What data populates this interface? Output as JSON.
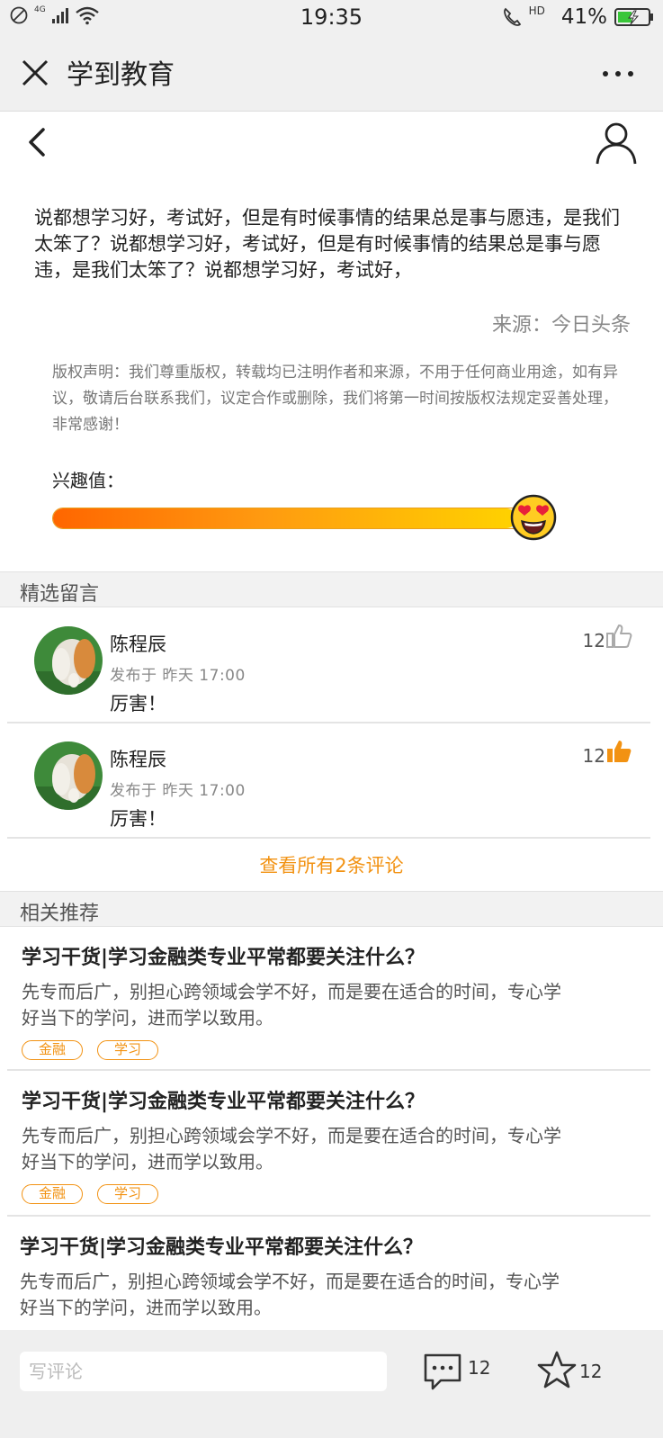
{
  "status_bar": {
    "network": "4G",
    "time": "19:35",
    "call_badge": "HD",
    "battery": "41%"
  },
  "title_bar": {
    "title": "学到教育"
  },
  "article": {
    "body": "说都想学习好，考试好，但是有时候事情的结果总是事与愿违，是我们太笨了？说都想学习好，考试好，但是有时候事情的结果总是事与愿违，是我们太笨了？说都想学习好，考试好，",
    "source": "来源：今日头条",
    "copyright": "版权声明：我们尊重版权，转载均已注明作者和来源，不用于任何商业用途，如有异议，敬请后台联系我们，议定合作或删除，我们将第一时间按版权法规定妥善处理，非常感谢！",
    "interest_label": "兴趣值：",
    "interest_value_percent": 95
  },
  "comments_section": {
    "title": "精选留言",
    "comments": [
      {
        "name": "陈程辰",
        "time": "发布于 昨天 17:00",
        "text": "厉害！",
        "likes": "12",
        "liked": false
      },
      {
        "name": "陈程辰",
        "time": "发布于 昨天 17:00",
        "text": "厉害！",
        "likes": "12",
        "liked": true
      }
    ],
    "view_all": "查看所有2条评论"
  },
  "recommend_section": {
    "title": "相关推荐",
    "items": [
      {
        "title": "学习干货|学习金融类专业平常都要关注什么？",
        "desc": "先专而后广，别担心跨领域会学不好，而是要在适合的时间，专心学好当下的学问，进而学以致用。",
        "tags": [
          "金融",
          "学习"
        ]
      },
      {
        "title": "学习干货|学习金融类专业平常都要关注什么？",
        "desc": "先专而后广，别担心跨领域会学不好，而是要在适合的时间，专心学好当下的学问，进而学以致用。",
        "tags": [
          "金融",
          "学习"
        ]
      },
      {
        "title": "学习干货|学习金融类专业平常都要关注什么？",
        "desc": "先专而后广，别担心跨领域会学不好，而是要在适合的时间，专心学好当下的学问，进而学以致用。",
        "tags": []
      }
    ]
  },
  "bottom_bar": {
    "comment_placeholder": "写评论",
    "comment_count": "12",
    "star_count": "12"
  },
  "colors": {
    "accent": "#f29212",
    "bar_start": "#ff6600",
    "bar_end": "#ffd200"
  }
}
